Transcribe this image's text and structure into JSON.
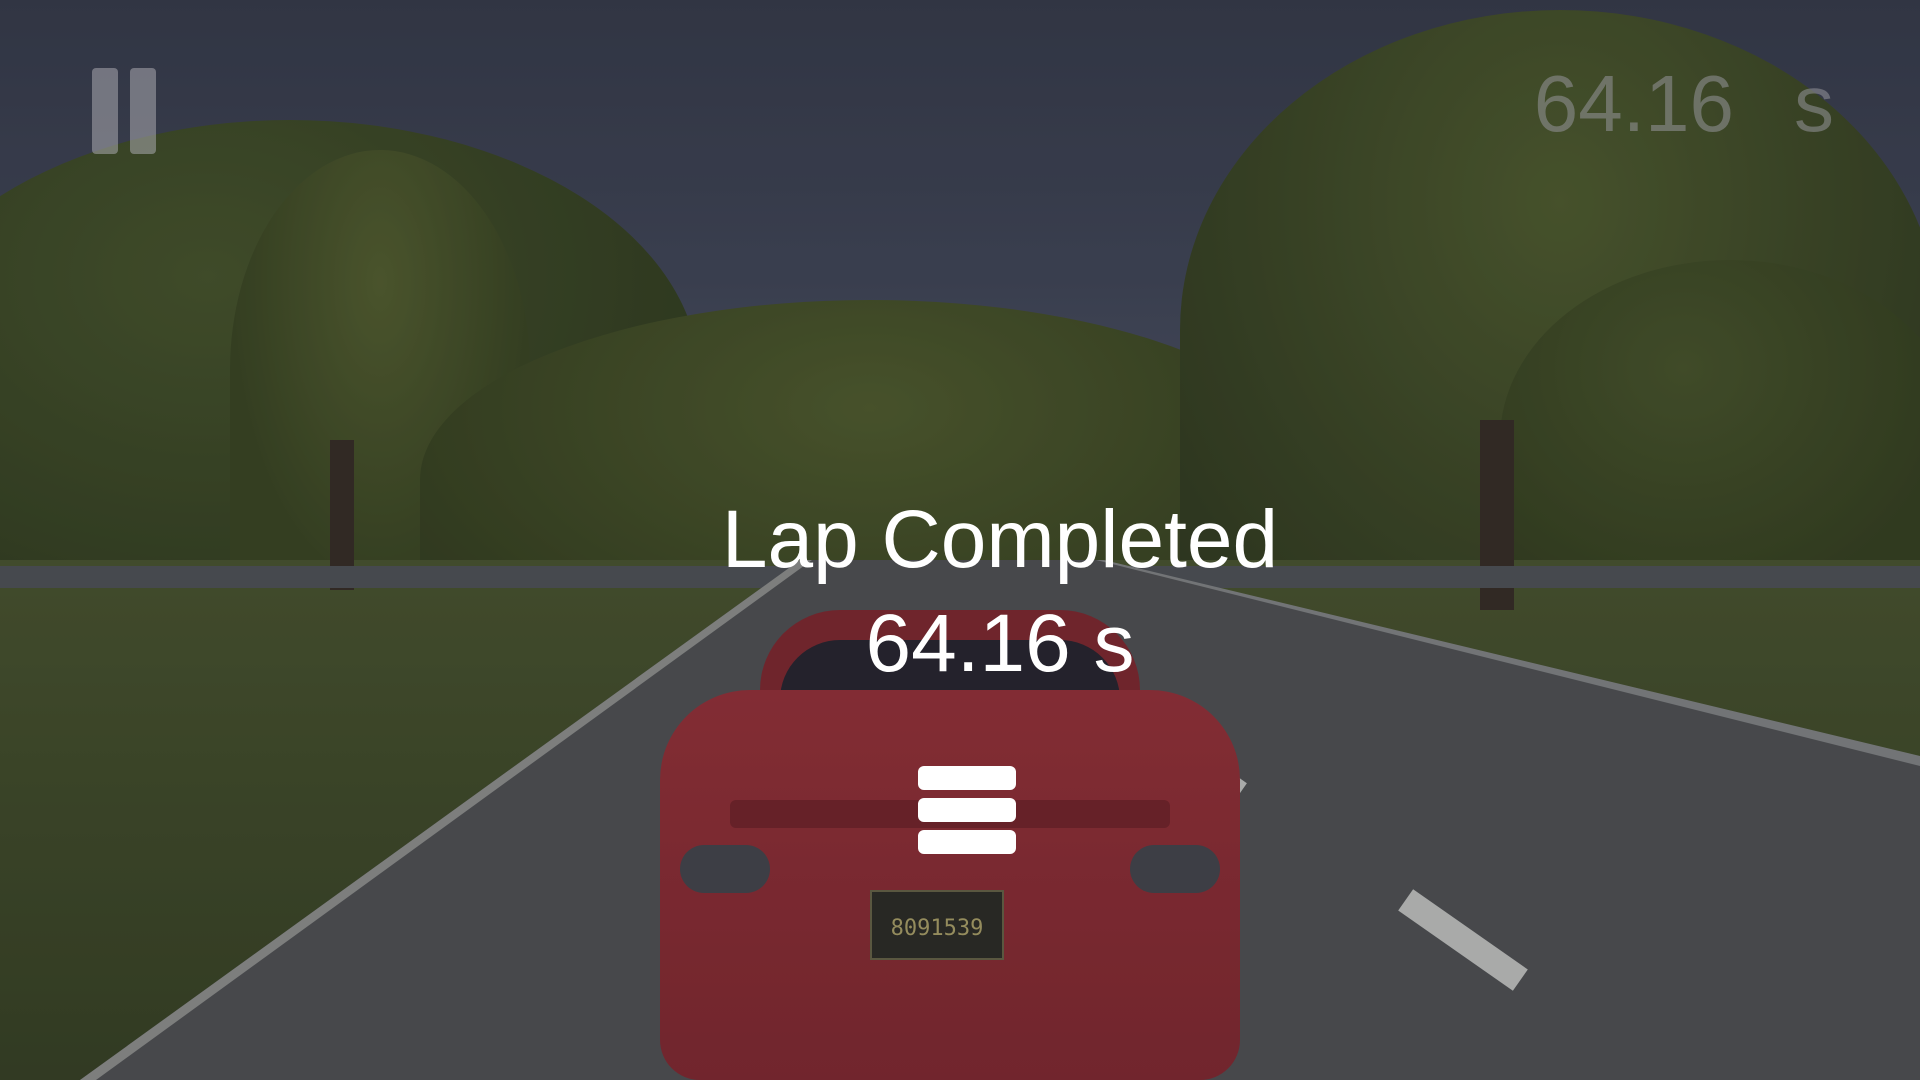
{
  "hud": {
    "pause_icon": "pause-icon",
    "timer_value": "64.16",
    "timer_unit": "s"
  },
  "result": {
    "title": "Lap Completed",
    "time": "64.16 s",
    "menu_icon": "hamburger-menu-icon"
  },
  "scene": {
    "license_plate": "8091539",
    "car_color": "#a2333a"
  }
}
